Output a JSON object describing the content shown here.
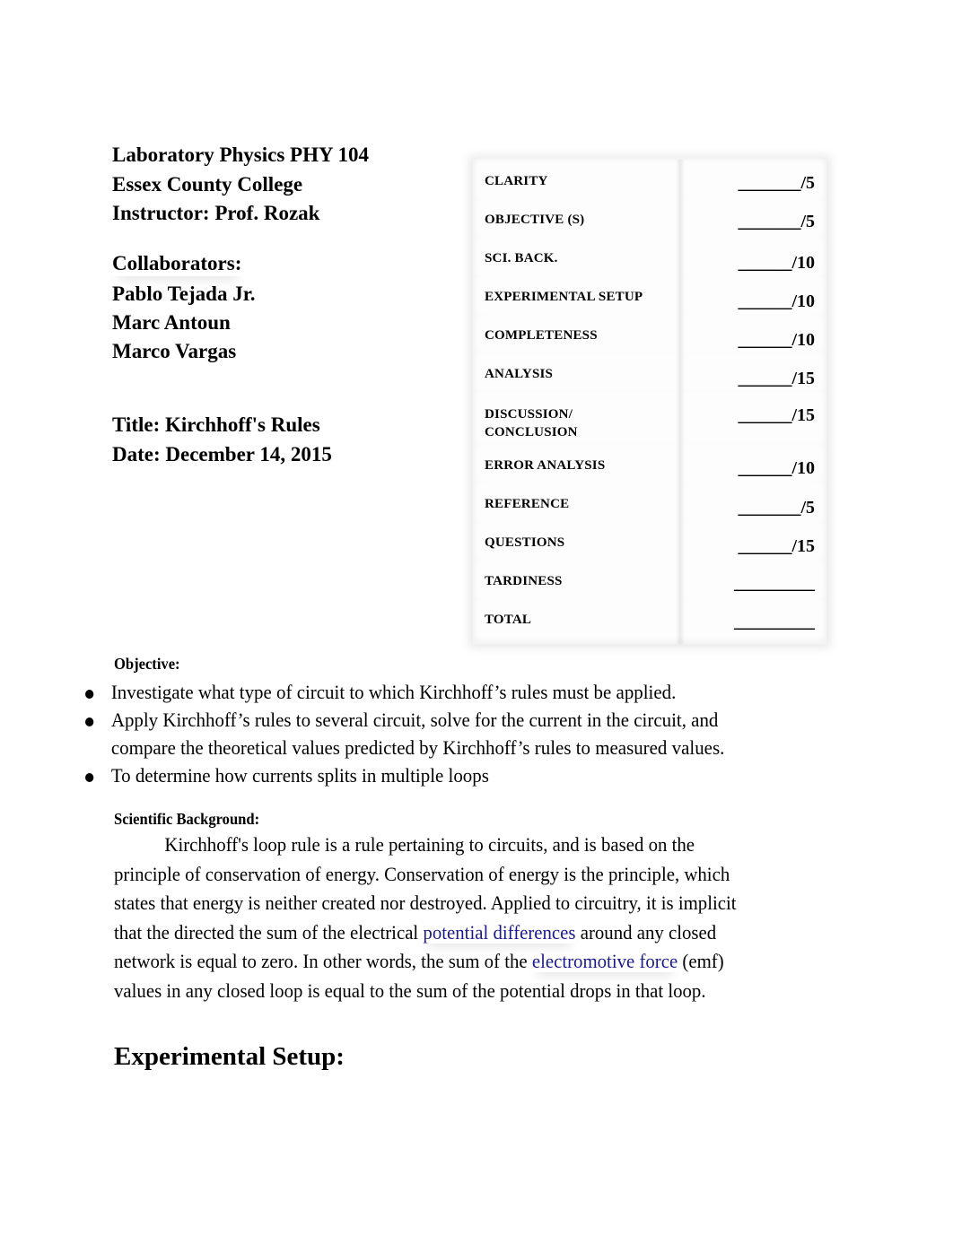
{
  "header": {
    "course": "Laboratory Physics PHY 104",
    "college": "Essex County College",
    "instructor": "Instructor: Prof. Rozak",
    "collaborators_label": "Collaborators:",
    "collaborators": [
      "Pablo Tejada Jr.",
      "Marc Antoun",
      "Marco Vargas"
    ],
    "title": "Title: Kirchhoff's Rules",
    "date": "Date: December 14, 2015"
  },
  "rubric": {
    "rows": [
      {
        "label": "CLARITY",
        "score": "_______/5"
      },
      {
        "label": "OBJECTIVE (S)",
        "score": "_______/5"
      },
      {
        "label": "SCI. BACK.",
        "score": "______/10"
      },
      {
        "label": "EXPERIMENTAL SETUP",
        "score": "______/10"
      },
      {
        "label": "COMPLETENESS",
        "score": "______/10"
      },
      {
        "label": "ANALYSIS",
        "score": "______/15"
      },
      {
        "label": "DISCUSSION/",
        "label2": "CONCLUSION",
        "score": "______/15"
      },
      {
        "label": "ERROR ANALYSIS",
        "score": "______/10"
      },
      {
        "label": "REFERENCE",
        "score": "_______/5"
      },
      {
        "label": "QUESTIONS",
        "score": "______/15"
      },
      {
        "label": "TARDINESS",
        "score": "_________"
      },
      {
        "label": "TOTAL",
        "score": "_________"
      }
    ]
  },
  "objective": {
    "heading": "Objective:",
    "bullets": [
      "Investigate what type of circuit to which Kirchhoff’s rules must be applied.",
      "Apply Kirchhoff’s rules to several circuit, solve for the current in  the circuit, and",
      "compare the theoretical values predicted by Kirchhoff’s rules to measured values.",
      "To determine how currents splits in multiple loops"
    ]
  },
  "scientific_background": {
    "heading": "Scientific Background:",
    "lines": [
      "Kirchhoff's loop rule is a rule pertaining to circuits, and is based on the",
      "principle of conservation of energy. Conservation of energy is the principle, which",
      "states that energy is neither created nor destroyed. Applied to circuitry, it is implicit"
    ],
    "line4_pre": "that the directed the sum of the electrical ",
    "link1": "potential differences",
    "line4_post": " around any closed",
    "line5_pre": "network is equal to zero. In other words, the sum of the ",
    "link2": "electromotive force",
    "line5_post": " (emf)",
    "line6": "values in any closed loop is equal to the sum of the potential drops in that loop.",
    "link_color": "#1a1a8c"
  },
  "experimental_setup": {
    "heading": "Experimental Setup:"
  }
}
